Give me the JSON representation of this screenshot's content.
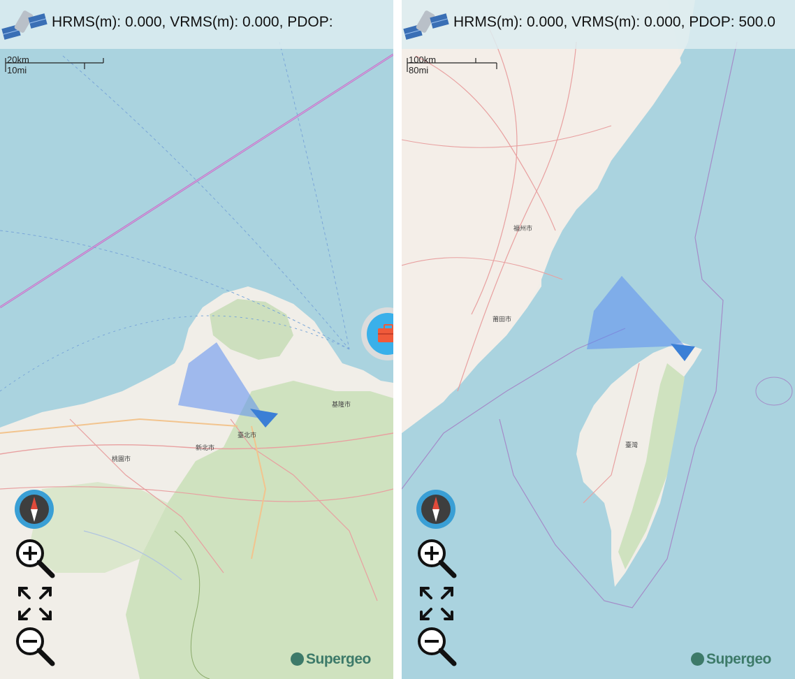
{
  "panels": [
    {
      "status": {
        "text": "HRMS(m): 0.000, VRMS(m): 0.000, PDOP:",
        "icon": "satellite-icon"
      },
      "scale": {
        "metric": "20km",
        "imperial": "10mi"
      },
      "controls": [
        "compass-icon",
        "zoom-in-icon",
        "fullscreen-icon",
        "zoom-out-icon"
      ],
      "extra_button": "toolbox-icon",
      "brand": "Supergeo"
    },
    {
      "status": {
        "text": "HRMS(m): 0.000, VRMS(m): 0.000, PDOP: 500.0",
        "icon": "satellite-icon"
      },
      "scale": {
        "metric": "100km",
        "imperial": "80mi"
      },
      "controls": [
        "compass-icon",
        "zoom-in-icon",
        "fullscreen-icon",
        "zoom-out-icon"
      ],
      "brand": "Supergeo"
    }
  ],
  "colors": {
    "sea": "#aad3df",
    "land": "#f1eee8",
    "forest": "#add19e",
    "direction_cone": "#5b8ef0",
    "control_ring": "#3a9fd5",
    "toolbox": "#3ab0ea",
    "brand": "#3d7a69"
  }
}
